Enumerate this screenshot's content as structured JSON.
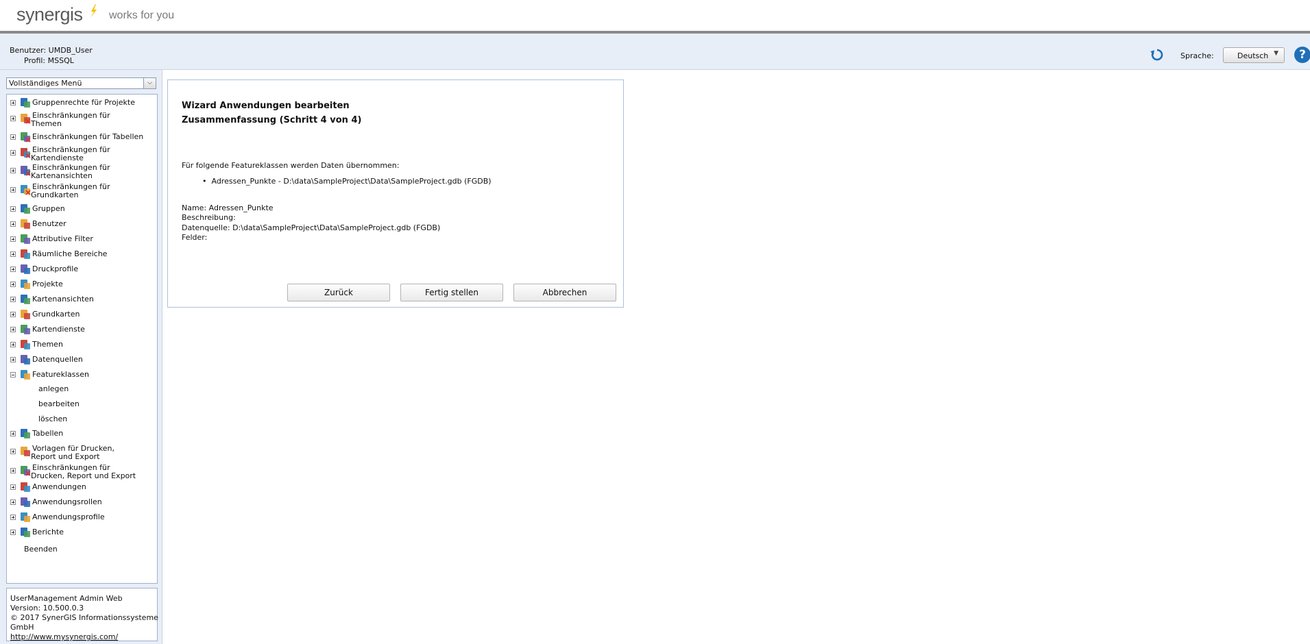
{
  "brand": {
    "logo_text": "synergis",
    "tagline": "works for you",
    "accent": "#f2c100"
  },
  "user_panel": {
    "user_label": "Benutzer:",
    "user_value": "UMDB_User",
    "profile_label": "Profil:",
    "profile_value": "MSSQL"
  },
  "toolbar": {
    "language_label": "Sprache:",
    "language_value": "Deutsch"
  },
  "menu_select": {
    "value": "Vollständiges Menü"
  },
  "tree": {
    "items": [
      {
        "line1": "Gruppenrechte für Projekte",
        "line2": "",
        "icon": "group-rights-icon"
      },
      {
        "line1": "Einschränkungen für",
        "line2": "Themen",
        "icon": "restriction-themes-icon"
      },
      {
        "line1": "Einschränkungen für Tabellen",
        "line2": "",
        "icon": "restriction-tables-icon"
      },
      {
        "line1": "Einschränkungen für",
        "line2": "Kartendienste",
        "icon": "restriction-mapservices-icon"
      },
      {
        "line1": "Einschränkungen für",
        "line2": "Kartenansichten",
        "icon": "restriction-mapviews-icon"
      },
      {
        "line1": "Einschränkungen für",
        "line2": "Grundkarten",
        "icon": "restriction-basemaps-icon"
      },
      {
        "line1": "Gruppen",
        "line2": "",
        "icon": "groups-icon"
      },
      {
        "line1": "Benutzer",
        "line2": "",
        "icon": "user-icon"
      },
      {
        "line1": "Attributive Filter",
        "line2": "",
        "icon": "filter-icon"
      },
      {
        "line1": "Räumliche Bereiche",
        "line2": "",
        "icon": "spatial-area-icon"
      },
      {
        "line1": "Druckprofile",
        "line2": "",
        "icon": "printer-icon"
      },
      {
        "line1": "Projekte",
        "line2": "",
        "icon": "project-icon"
      },
      {
        "line1": "Kartenansichten",
        "line2": "",
        "icon": "mapview-icon"
      },
      {
        "line1": "Grundkarten",
        "line2": "",
        "icon": "basemap-icon"
      },
      {
        "line1": "Kartendienste",
        "line2": "",
        "icon": "mapservice-icon"
      },
      {
        "line1": "Themen",
        "line2": "",
        "icon": "themes-icon"
      },
      {
        "line1": "Datenquellen",
        "line2": "",
        "icon": "database-icon"
      },
      {
        "line1": "Featureklassen",
        "line2": "",
        "icon": "featureclass-icon"
      },
      {
        "line1": "Tabellen",
        "line2": "",
        "icon": "table-icon"
      },
      {
        "line1": "Vorlagen für Drucken,",
        "line2": "Report und Export",
        "icon": "template-icon"
      },
      {
        "line1": "Einschränkungen für",
        "line2": "Drucken, Report und Export",
        "icon": "restriction-template-icon"
      },
      {
        "line1": "Anwendungen",
        "line2": "",
        "icon": "application-icon"
      },
      {
        "line1": "Anwendungsrollen",
        "line2": "",
        "icon": "app-role-icon"
      },
      {
        "line1": "Anwendungsprofile",
        "line2": "",
        "icon": "app-profile-icon"
      },
      {
        "line1": "Berichte",
        "line2": "",
        "icon": "report-icon"
      }
    ],
    "featureclass_children": [
      "anlegen",
      "bearbeiten",
      "löschen"
    ],
    "exit_label": "Beenden"
  },
  "info": {
    "app_name": "UserManagement Admin Web",
    "version": "Version: 10.500.0.3",
    "copyright_line1": "© 2017 SynerGIS Informationssysteme",
    "copyright_line2": "GmbH",
    "link": "http://www.mysynergis.com/"
  },
  "wizard": {
    "title": "Wizard Anwendungen bearbeiten",
    "step": "Zusammenfassung (Schritt 4 von 4)",
    "intro": "Für folgende Featureklassen werden Daten übernommen:",
    "bullet": "Adressen_Punkte - D:\\data\\SampleProject\\Data\\SampleProject.gdb (FGDB)",
    "name_line": "Name: Adressen_Punkte",
    "description_line": "Beschreibung:",
    "source_line": "Datenquelle: D:\\data\\SampleProject\\Data\\SampleProject.gdb (FGDB)",
    "fields_line": "Felder:",
    "buttons": {
      "back": "Zurück",
      "finish": "Fertig stellen",
      "cancel": "Abbrechen"
    }
  }
}
